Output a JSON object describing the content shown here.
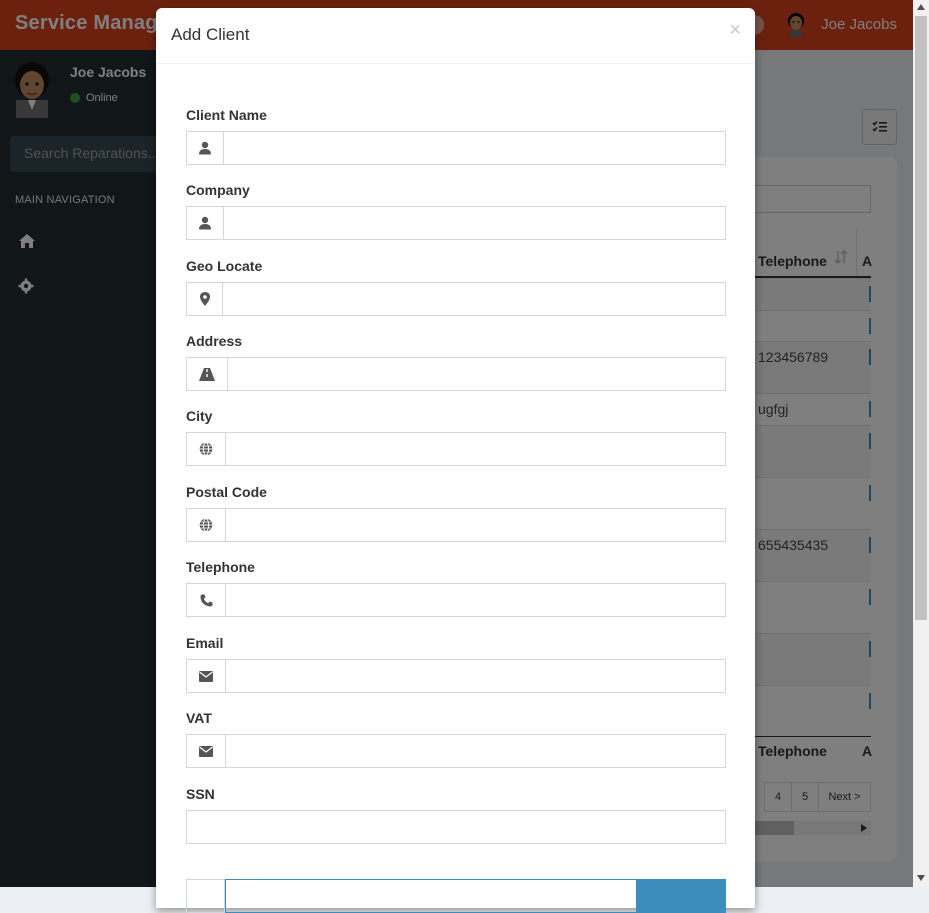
{
  "header": {
    "logo_text": "Service Manag",
    "user_name": "Joe Jacobs"
  },
  "sidebar": {
    "user_name": "Joe Jacobs",
    "user_status": "Online",
    "search_placeholder": "Search Reparations...",
    "nav_header": "MAIN NAVIGATION",
    "items": [
      {
        "icon": "home-icon"
      },
      {
        "icon": "gear-icon"
      }
    ]
  },
  "background_table": {
    "column_header": "Telephone",
    "next_column_header": "A",
    "footer_header": "Telephone",
    "footer_next_column_header": "A",
    "rows": [
      "",
      "",
      "123456789",
      "ugfgj",
      "",
      "",
      "655435435",
      "",
      "",
      ""
    ],
    "pagination": [
      "4",
      "5",
      "Next >"
    ]
  },
  "modal": {
    "title": "Add Client",
    "close_label": "×",
    "fields": [
      {
        "label": "Client Name",
        "icon": "user-icon"
      },
      {
        "label": "Company",
        "icon": "user-icon"
      },
      {
        "label": "Geo Locate",
        "icon": "map-marker-icon"
      },
      {
        "label": "Address",
        "icon": "road-icon"
      },
      {
        "label": "City",
        "icon": "globe-icon"
      },
      {
        "label": "Postal Code",
        "icon": "globe-icon"
      },
      {
        "label": "Telephone",
        "icon": "phone-icon"
      },
      {
        "label": "Email",
        "icon": "envelope-icon"
      },
      {
        "label": "VAT",
        "icon": "envelope-icon"
      },
      {
        "label": "SSN",
        "icon": ""
      }
    ]
  },
  "colors": {
    "header": "#d9421c",
    "sidebar": "#222d32",
    "primary": "#3c8dbc"
  }
}
